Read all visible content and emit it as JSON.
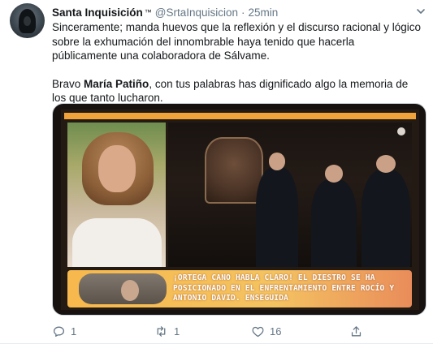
{
  "tweet": {
    "author_name": "Santa Inquisición",
    "author_badge": "™",
    "handle": "@SrtaInquisicion",
    "separator": "·",
    "time": "25min",
    "paragraph1": "Sinceramente; manda huevos que la reflexión y el discurso racional y lógico sobre la exhumación del innombrable haya tenido que hacerla públicamente una colaboradora de Sálvame.",
    "paragraph2_prefix": "Bravo ",
    "paragraph2_bold": "María Patiño",
    "paragraph2_suffix": ", con tus palabras has dignificado algo la memoria de los que tanto lucharon."
  },
  "media": {
    "banner_text": "¡ORTEGA CANO HABLA CLARO! EL DIESTRO SE HA POSICIONADO EN EL ENFRENTAMIENTO ENTRE ROCÍO Y ANTONIO DAVID. ENSEGUIDA"
  },
  "actions": {
    "reply_count": "1",
    "retweet_count": "1",
    "like_count": "16"
  },
  "icons": {
    "menu": "chevron-down-icon",
    "reply": "reply-icon",
    "retweet": "retweet-icon",
    "like": "heart-icon",
    "share": "share-icon"
  },
  "colors": {
    "text": "#14171a",
    "secondary": "#657786",
    "banner": "#f4c361"
  }
}
